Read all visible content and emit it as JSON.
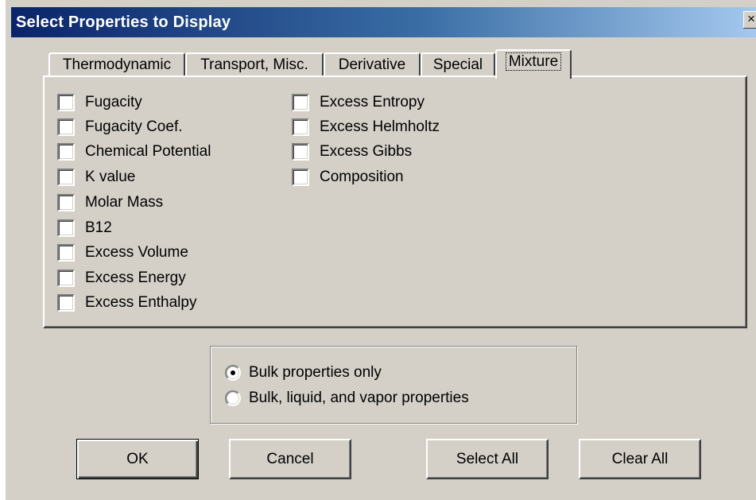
{
  "window": {
    "title": "Select Properties to Display",
    "close_glyph": "×"
  },
  "tabs": [
    {
      "label": "Thermodynamic",
      "active": false
    },
    {
      "label": "Transport, Misc.",
      "active": false
    },
    {
      "label": "Derivative",
      "active": false
    },
    {
      "label": "Special",
      "active": false
    },
    {
      "label": "Mixture",
      "active": true
    }
  ],
  "checkboxes": {
    "col1": [
      {
        "label": "Fugacity",
        "checked": false
      },
      {
        "label": "Fugacity Coef.",
        "checked": false
      },
      {
        "label": "Chemical Potential",
        "checked": false
      },
      {
        "label": "K value",
        "checked": false
      },
      {
        "label": "Molar Mass",
        "checked": false
      },
      {
        "label": "B12",
        "checked": false
      },
      {
        "label": "Excess Volume",
        "checked": false
      },
      {
        "label": "Excess Energy",
        "checked": false
      },
      {
        "label": "Excess Enthalpy",
        "checked": false
      }
    ],
    "col2": [
      {
        "label": "Excess Entropy",
        "checked": false
      },
      {
        "label": "Excess Helmholtz",
        "checked": false
      },
      {
        "label": "Excess Gibbs",
        "checked": false
      },
      {
        "label": "Composition",
        "checked": false
      }
    ]
  },
  "radios": [
    {
      "label": "Bulk properties only",
      "checked": true
    },
    {
      "label": "Bulk, liquid, and vapor properties",
      "checked": false
    }
  ],
  "buttons": {
    "ok": "OK",
    "cancel": "Cancel",
    "select_all": "Select All",
    "clear_all": "Clear All"
  }
}
